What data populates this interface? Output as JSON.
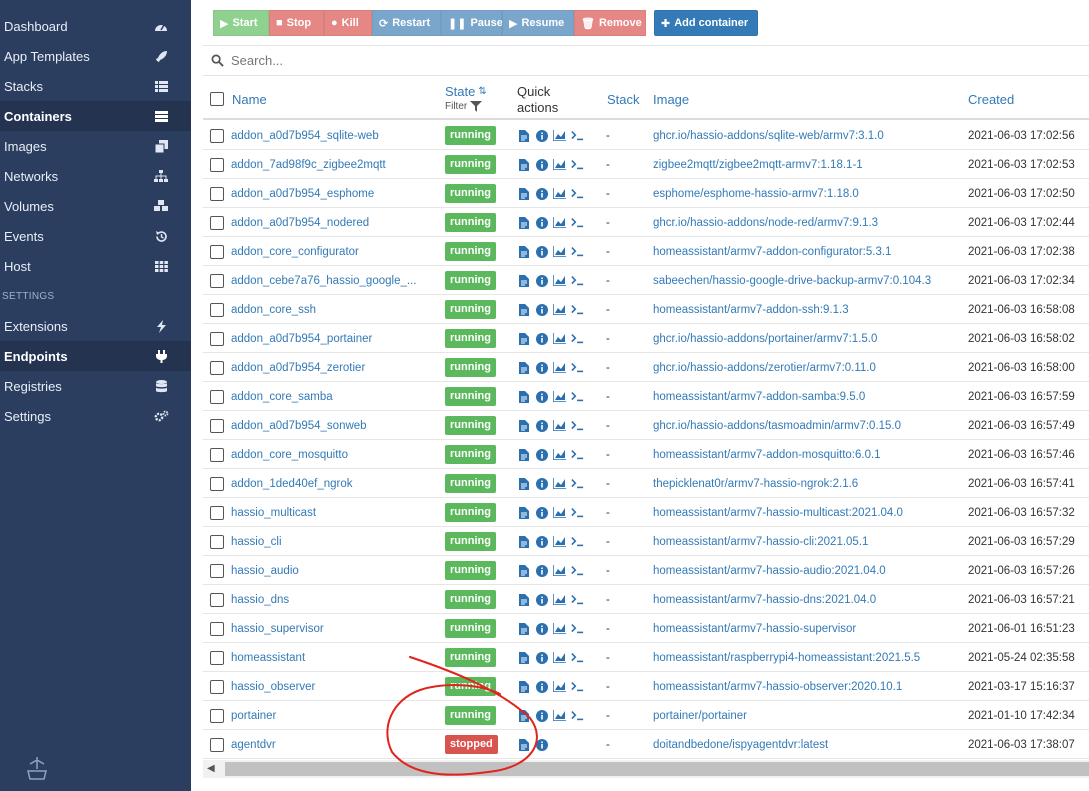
{
  "sidebar": {
    "items": [
      {
        "label": "Dashboard",
        "icon": "tachometer-icon",
        "active": false
      },
      {
        "label": "App Templates",
        "icon": "rocket-icon",
        "active": false
      },
      {
        "label": "Stacks",
        "icon": "th-list-icon",
        "active": false
      },
      {
        "label": "Containers",
        "icon": "server-icon",
        "active": true
      },
      {
        "label": "Images",
        "icon": "clone-icon",
        "active": false
      },
      {
        "label": "Networks",
        "icon": "sitemap-icon",
        "active": false
      },
      {
        "label": "Volumes",
        "icon": "cubes-icon",
        "active": false
      },
      {
        "label": "Events",
        "icon": "history-icon",
        "active": false
      },
      {
        "label": "Host",
        "icon": "th-icon",
        "active": false
      }
    ],
    "settings_label": "SETTINGS",
    "settings_items": [
      {
        "label": "Extensions",
        "icon": "bolt-icon",
        "active": false
      },
      {
        "label": "Endpoints",
        "icon": "plug-icon",
        "active": true
      },
      {
        "label": "Registries",
        "icon": "database-icon",
        "active": false
      },
      {
        "label": "Settings",
        "icon": "cogs-icon",
        "active": false
      }
    ]
  },
  "toolbar": {
    "start": "Start",
    "stop": "Stop",
    "kill": "Kill",
    "restart": "Restart",
    "pause": "Pause",
    "resume": "Resume",
    "remove": "Remove",
    "add": "Add container"
  },
  "search": {
    "placeholder": "Search..."
  },
  "table": {
    "headers": {
      "name": "Name",
      "state": "State",
      "filter": "Filter",
      "quick_actions_1": "Quick",
      "quick_actions_2": "actions",
      "stack": "Stack",
      "image": "Image",
      "created": "Created"
    },
    "rows": [
      {
        "name": "addon_a0d7b954_sqlite-web",
        "state": "running",
        "stack": "-",
        "image": "ghcr.io/hassio-addons/sqlite-web/armv7:3.1.0",
        "created": "2021-06-03 17:02:56"
      },
      {
        "name": "addon_7ad98f9c_zigbee2mqtt",
        "state": "running",
        "stack": "-",
        "image": "zigbee2mqtt/zigbee2mqtt-armv7:1.18.1-1",
        "created": "2021-06-03 17:02:53"
      },
      {
        "name": "addon_a0d7b954_esphome",
        "state": "running",
        "stack": "-",
        "image": "esphome/esphome-hassio-armv7:1.18.0",
        "created": "2021-06-03 17:02:50"
      },
      {
        "name": "addon_a0d7b954_nodered",
        "state": "running",
        "stack": "-",
        "image": "ghcr.io/hassio-addons/node-red/armv7:9.1.3",
        "created": "2021-06-03 17:02:44"
      },
      {
        "name": "addon_core_configurator",
        "state": "running",
        "stack": "-",
        "image": "homeassistant/armv7-addon-configurator:5.3.1",
        "created": "2021-06-03 17:02:38"
      },
      {
        "name": "addon_cebe7a76_hassio_google_...",
        "state": "running",
        "stack": "-",
        "image": "sabeechen/hassio-google-drive-backup-armv7:0.104.3",
        "created": "2021-06-03 17:02:34"
      },
      {
        "name": "addon_core_ssh",
        "state": "running",
        "stack": "-",
        "image": "homeassistant/armv7-addon-ssh:9.1.3",
        "created": "2021-06-03 16:58:08"
      },
      {
        "name": "addon_a0d7b954_portainer",
        "state": "running",
        "stack": "-",
        "image": "ghcr.io/hassio-addons/portainer/armv7:1.5.0",
        "created": "2021-06-03 16:58:02"
      },
      {
        "name": "addon_a0d7b954_zerotier",
        "state": "running",
        "stack": "-",
        "image": "ghcr.io/hassio-addons/zerotier/armv7:0.11.0",
        "created": "2021-06-03 16:58:00"
      },
      {
        "name": "addon_core_samba",
        "state": "running",
        "stack": "-",
        "image": "homeassistant/armv7-addon-samba:9.5.0",
        "created": "2021-06-03 16:57:59"
      },
      {
        "name": "addon_a0d7b954_sonweb",
        "state": "running",
        "stack": "-",
        "image": "ghcr.io/hassio-addons/tasmoadmin/armv7:0.15.0",
        "created": "2021-06-03 16:57:49"
      },
      {
        "name": "addon_core_mosquitto",
        "state": "running",
        "stack": "-",
        "image": "homeassistant/armv7-addon-mosquitto:6.0.1",
        "created": "2021-06-03 16:57:46"
      },
      {
        "name": "addon_1ded40ef_ngrok",
        "state": "running",
        "stack": "-",
        "image": "thepicklenat0r/armv7-hassio-ngrok:2.1.6",
        "created": "2021-06-03 16:57:41"
      },
      {
        "name": "hassio_multicast",
        "state": "running",
        "stack": "-",
        "image": "homeassistant/armv7-hassio-multicast:2021.04.0",
        "created": "2021-06-03 16:57:32"
      },
      {
        "name": "hassio_cli",
        "state": "running",
        "stack": "-",
        "image": "homeassistant/armv7-hassio-cli:2021.05.1",
        "created": "2021-06-03 16:57:29"
      },
      {
        "name": "hassio_audio",
        "state": "running",
        "stack": "-",
        "image": "homeassistant/armv7-hassio-audio:2021.04.0",
        "created": "2021-06-03 16:57:26"
      },
      {
        "name": "hassio_dns",
        "state": "running",
        "stack": "-",
        "image": "homeassistant/armv7-hassio-dns:2021.04.0",
        "created": "2021-06-03 16:57:21"
      },
      {
        "name": "hassio_supervisor",
        "state": "running",
        "stack": "-",
        "image": "homeassistant/armv7-hassio-supervisor",
        "created": "2021-06-01 16:51:23"
      },
      {
        "name": "homeassistant",
        "state": "running",
        "stack": "-",
        "image": "homeassistant/raspberrypi4-homeassistant:2021.5.5",
        "created": "2021-05-24 02:35:58"
      },
      {
        "name": "hassio_observer",
        "state": "running",
        "stack": "-",
        "image": "homeassistant/armv7-hassio-observer:2020.10.1",
        "created": "2021-03-17 15:16:37"
      },
      {
        "name": "portainer",
        "state": "running",
        "stack": "-",
        "image": "portainer/portainer",
        "created": "2021-01-10 17:42:34"
      },
      {
        "name": "agentdvr",
        "state": "stopped",
        "stack": "-",
        "image": "doitandbedone/ispyagentdvr:latest",
        "created": "2021-06-03 17:38:07"
      }
    ]
  },
  "colors": {
    "sidebar_bg": "#2c3e60",
    "running": "#5cb85c",
    "stopped": "#d9534f",
    "link": "#337ab7",
    "annotation": "#e0241c"
  }
}
